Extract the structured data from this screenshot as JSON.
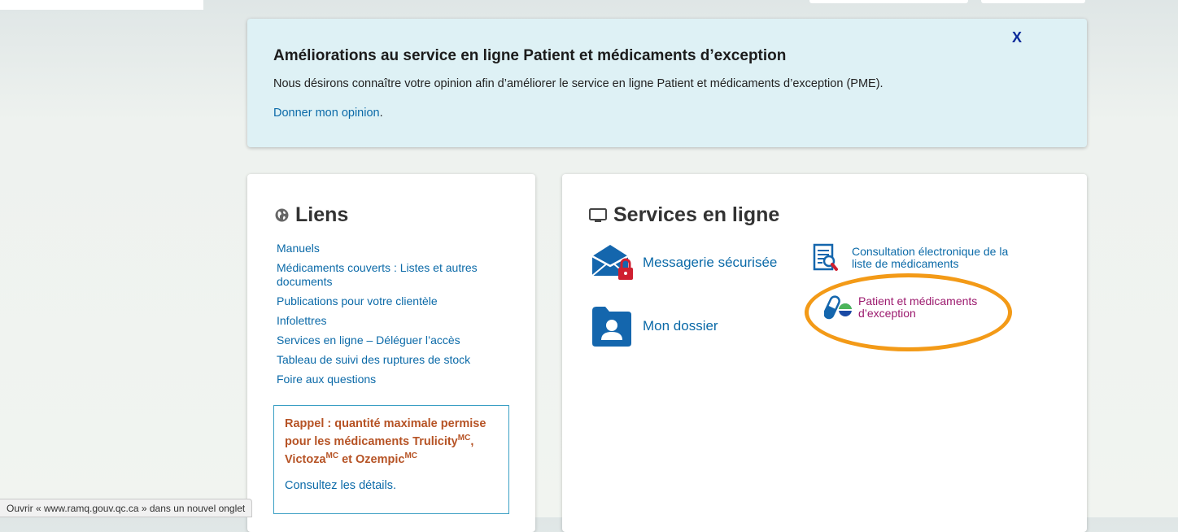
{
  "banner": {
    "close_label": "X",
    "title": "Améliorations au service en ligne Patient et médicaments d’exception",
    "text": "Nous désirons connaître votre opinion afin d’améliorer le service en ligne Patient et médicaments d’exception (PME).",
    "link_label": "Donner mon opinion",
    "link_suffix": "."
  },
  "liens": {
    "heading": "Liens",
    "icon": "globe-icon",
    "items": [
      {
        "label": "Manuels"
      },
      {
        "label": "Médicaments couverts : Listes et autres documents"
      },
      {
        "label": "Publications pour votre clientèle"
      },
      {
        "label": "Infolettres"
      },
      {
        "label": "Services en ligne – Déléguer l’accès"
      },
      {
        "label": "Tableau de suivi des ruptures de stock"
      },
      {
        "label": "Foire aux questions"
      }
    ],
    "rappel": {
      "title_part1": "Rappel : quantité maximale permise pour les médicaments Trulicity",
      "sup1": "MC",
      "title_part2": ", Victoza",
      "sup2": "MC",
      "title_part3": " et Ozempic",
      "sup3": "MC",
      "link_label": "Consultez les détails."
    }
  },
  "services": {
    "heading": "Services en ligne",
    "icon": "monitor-icon",
    "items": {
      "messagerie": {
        "label": "Messagerie sécurisée",
        "icon": "secure-mail-icon"
      },
      "dossier": {
        "label": "Mon dossier",
        "icon": "user-folder-icon"
      },
      "consultation": {
        "label": "Consultation électronique de la liste de médicaments",
        "icon": "document-search-icon"
      },
      "pme": {
        "label": "Patient et médicaments d’exception",
        "icon": "pill-capsule-icon"
      }
    },
    "highlight_color": "#f39a17"
  },
  "statusbar": {
    "text": "Ouvrir « www.ramq.gouv.qc.ca » dans un nouvel onglet"
  },
  "colors": {
    "link": "#0b6aa8",
    "banner_bg": "#def1f5",
    "rappel_title": "#b65325",
    "pme_link": "#9c1a6e"
  }
}
